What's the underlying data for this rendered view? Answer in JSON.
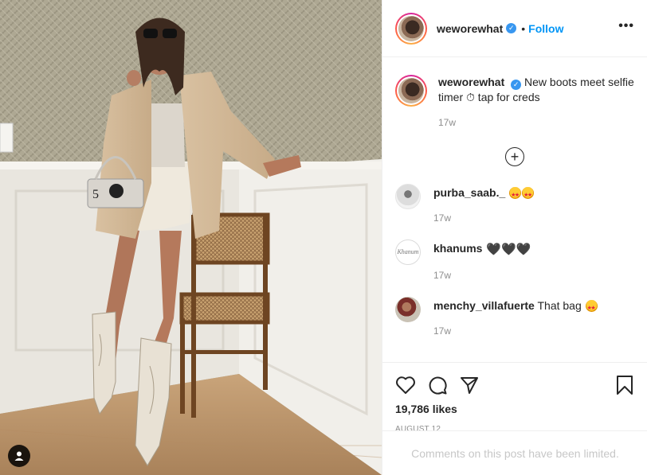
{
  "post": {
    "username": "weworewhat",
    "follow_label": "Follow",
    "separator": "•",
    "more_label": "•••",
    "caption": "New boots meet selfie timer ⏱ tap for creds",
    "caption_time": "17w",
    "load_more_label": "+"
  },
  "comments": [
    {
      "username": "purba_saab._",
      "text": "",
      "emoji": "star-struck x2",
      "time": "17w"
    },
    {
      "username": "khanums",
      "text": "🖤🖤🖤",
      "time": "17w"
    },
    {
      "username": "menchy_villafuerte",
      "text": "That bag",
      "emoji": "star-struck",
      "time": "17w"
    }
  ],
  "actions": {
    "like_icon": "heart-outline-icon",
    "comment_icon": "comment-bubble-icon",
    "share_icon": "paper-plane-icon",
    "save_icon": "bookmark-icon"
  },
  "likes": "19,786 likes",
  "date": "AUGUST 12",
  "comments_limited": "Comments on this post have been limited.",
  "colors": {
    "accent": "#0095f6",
    "verified": "#3897f0",
    "muted": "#8e8e8e",
    "border": "#efefef"
  }
}
